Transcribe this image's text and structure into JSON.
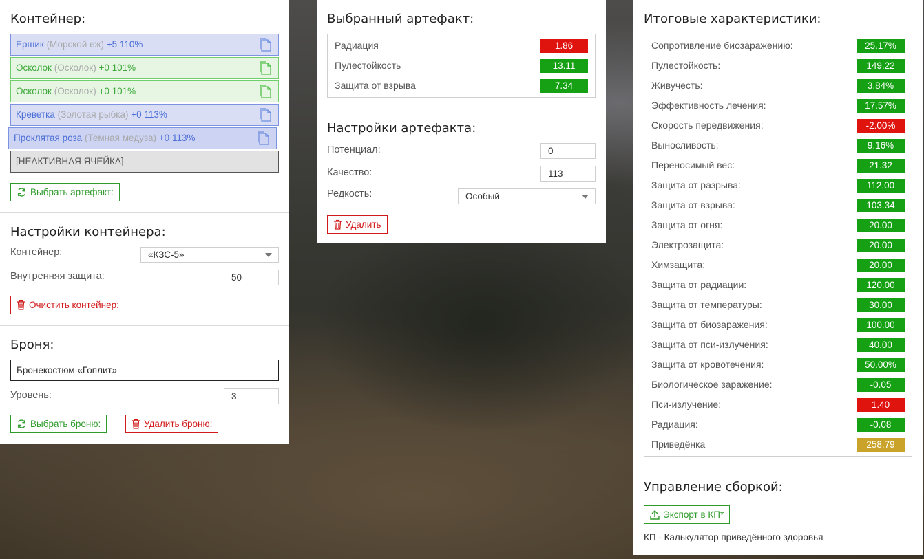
{
  "container_panel": {
    "title": "Контейнер:",
    "slots": [
      {
        "name": "Ершик",
        "sub": "(Морской еж)",
        "extra": "+5 110%",
        "color": "blue"
      },
      {
        "name": "Осколок",
        "sub": "(Осколок)",
        "extra": "+0 101%",
        "color": "green"
      },
      {
        "name": "Осколок",
        "sub": "(Осколок)",
        "extra": "+0 101%",
        "color": "green"
      },
      {
        "name": "Креветка",
        "sub": "(Золотая рыбка)",
        "extra": "+0 113%",
        "color": "blue"
      },
      {
        "name": "Проклятая роза",
        "sub": "(Темная медуза)",
        "extra": "+0 113%",
        "color": "blue"
      }
    ],
    "inactive_slot": "[НЕАКТИВНАЯ ЯЧЕЙКА]",
    "select_artifact_button": "Выбрать артефакт:"
  },
  "container_settings": {
    "title": "Настройки контейнера:",
    "container_label": "Контейнер:",
    "container_value": "«КЗС-5»",
    "internal_protection_label": "Внутренняя защита:",
    "internal_protection_value": "50",
    "clear_button": "Очистить контейнер:"
  },
  "armor": {
    "title": "Броня:",
    "armor_name": "Бронекостюм «Гоплит»",
    "level_label": "Уровень:",
    "level_value": "3",
    "select_button": "Выбрать броню:",
    "delete_button": "Удалить броню:"
  },
  "selected_artifact": {
    "title": "Выбранный артефакт:",
    "stats": [
      {
        "label": "Радиация",
        "value": "1.86",
        "status": "bad"
      },
      {
        "label": "Пулестойкость",
        "value": "13.11",
        "status": "good"
      },
      {
        "label": "Защита от взрыва",
        "value": "7.34",
        "status": "good"
      }
    ]
  },
  "artifact_settings": {
    "title": "Настройки артефакта:",
    "potential_label": "Потенциал:",
    "potential_value": "0",
    "quality_label": "Качество:",
    "quality_value": "113",
    "rarity_label": "Редкость:",
    "rarity_value": "Особый",
    "delete_button": "Удалить"
  },
  "totals": {
    "title": "Итоговые характеристики:",
    "stats": [
      {
        "label": "Сопротивление биозаражению:",
        "value": "25.17%",
        "status": "good"
      },
      {
        "label": "Пулестойкость:",
        "value": "149.22",
        "status": "good"
      },
      {
        "label": "Живучесть:",
        "value": "3.84%",
        "status": "good"
      },
      {
        "label": "Эффективность лечения:",
        "value": "17.57%",
        "status": "good"
      },
      {
        "label": "Скорость передвижения:",
        "value": "-2.00%",
        "status": "bad"
      },
      {
        "label": "Выносливость:",
        "value": "9.16%",
        "status": "good"
      },
      {
        "label": "Переносимый вес:",
        "value": "21.32",
        "status": "good"
      },
      {
        "label": "Защита от разрыва:",
        "value": "112.00",
        "status": "good"
      },
      {
        "label": "Защита от взрыва:",
        "value": "103.34",
        "status": "good"
      },
      {
        "label": "Защита от огня:",
        "value": "20.00",
        "status": "good"
      },
      {
        "label": "Электрозащита:",
        "value": "20.00",
        "status": "good"
      },
      {
        "label": "Химзащита:",
        "value": "20.00",
        "status": "good"
      },
      {
        "label": "Защита от радиации:",
        "value": "120.00",
        "status": "good"
      },
      {
        "label": "Защита от температуры:",
        "value": "30.00",
        "status": "good"
      },
      {
        "label": "Защита от биозаражения:",
        "value": "100.00",
        "status": "good"
      },
      {
        "label": "Защита от пси-излучения:",
        "value": "40.00",
        "status": "good"
      },
      {
        "label": "Защита от кровотечения:",
        "value": "50.00%",
        "status": "good"
      },
      {
        "label": "Биологическое заражение:",
        "value": "-0.05",
        "status": "good"
      },
      {
        "label": "Пси-излучение:",
        "value": "1.40",
        "status": "bad"
      },
      {
        "label": "Радиация:",
        "value": "-0.08",
        "status": "good"
      },
      {
        "label": "Приведёнка",
        "value": "258.79",
        "status": "gold"
      }
    ]
  },
  "build": {
    "title": "Управление сборкой:",
    "export_button": "Экспорт в КП*",
    "footnote": "КП - Калькулятор приведённого здоровья"
  },
  "colors": {
    "good": "#16a013",
    "bad": "#e0140f",
    "gold": "#c9a32a",
    "slot_blue": "#d9def5",
    "slot_green": "#e6f6e3"
  }
}
